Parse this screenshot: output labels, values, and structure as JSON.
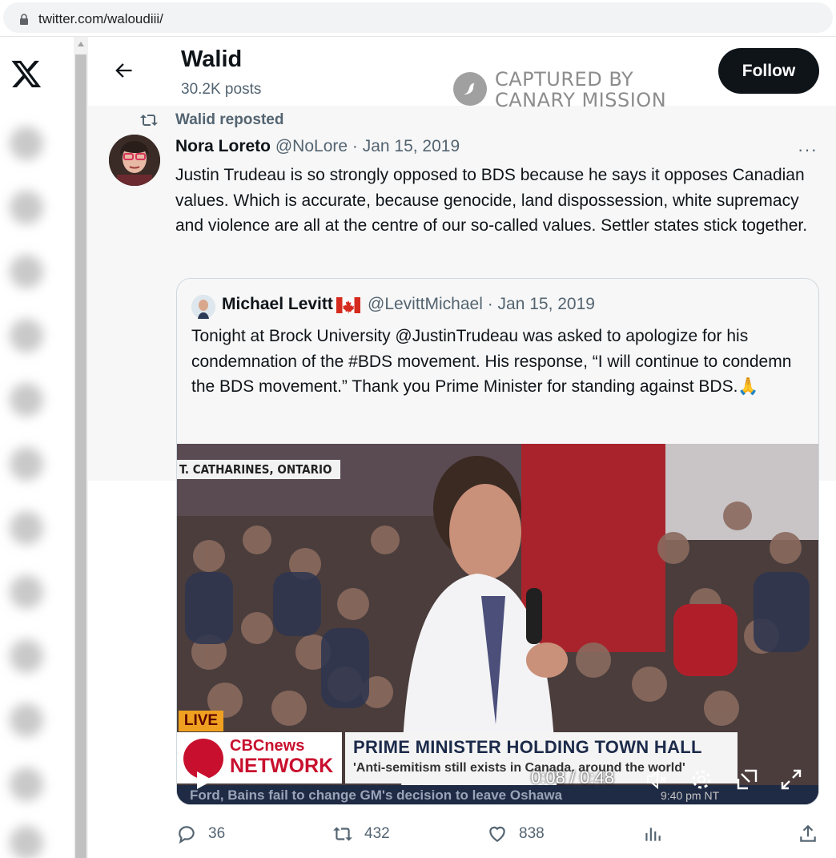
{
  "browser": {
    "url": "twitter.com/waloudiii/"
  },
  "header": {
    "name": "Walid",
    "posts": "30.2K posts",
    "follow_label": "Follow"
  },
  "watermark": {
    "line1": "CAPTURED BY",
    "line2": "CANARY MISSION"
  },
  "repost": {
    "label": "Walid reposted"
  },
  "tweet": {
    "author": "Nora Loreto",
    "meta": "@NoLore · Jan 15, 2019",
    "more": "···",
    "text": "Justin Trudeau is so strongly opposed to BDS because he says it opposes Canadian values. Which is accurate, because genocide, land dispossession, white supremacy and violence are all at the centre of our so-called values. Settler states stick together."
  },
  "quote": {
    "author": "Michael Levitt",
    "meta": "@LevittMichael · Jan 15, 2019",
    "text": "Tonight at Brock University @JustinTrudeau was asked to apologize for his condemnation of the #BDS movement. His response, “I will continue to condemn the BDS movement.” Thank you Prime Minister for standing against BDS.🙏"
  },
  "video": {
    "location": "T. CATHARINES, ONTARIO",
    "live": "LIVE",
    "cbc_line1": "CBCnews",
    "cbc_line2": "NETWORK",
    "headline": "PRIME MINISTER HOLDING TOWN HALL",
    "subline": "'Anti-semitism still exists in Canada, around the world'",
    "ticker": "Ford, Bains fail to change GM's decision to leave Oshawa",
    "ticker_time": "9:40 pm NT",
    "time": "0:08 / 0:48"
  },
  "actions": {
    "replies": "36",
    "reposts": "432",
    "likes": "838"
  }
}
